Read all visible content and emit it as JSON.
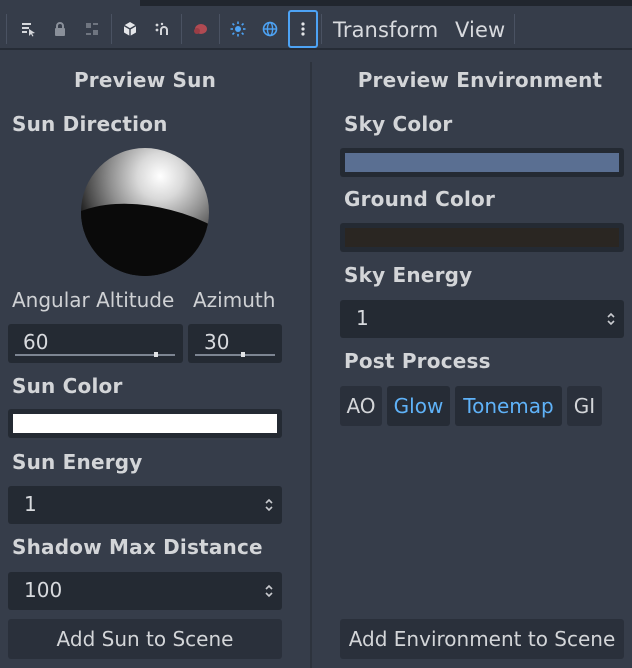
{
  "toolbar": {
    "icons": [
      "list-select-icon",
      "lock-icon",
      "group-icon",
      "cube-icon",
      "snap-icon",
      "paint-icon",
      "sun-icon",
      "globe-icon",
      "more-vertical-icon"
    ],
    "menus": [
      "Transform",
      "View"
    ]
  },
  "preview_sun": {
    "heading": "Preview Sun",
    "direction_label": "Sun Direction",
    "angular_altitude_label": "Angular Altitude",
    "azimuth_label": "Azimuth",
    "angular_altitude_value": "60",
    "azimuth_value": "30",
    "angular_altitude_fraction": 0.88,
    "azimuth_fraction": 0.6,
    "color_label": "Sun Color",
    "color": "#ffffff",
    "energy_label": "Sun Energy",
    "energy_value": "1",
    "shadow_label": "Shadow Max Distance",
    "shadow_value": "100",
    "add_button": "Add Sun to Scene"
  },
  "preview_environment": {
    "heading": "Preview Environment",
    "sky_color_label": "Sky Color",
    "sky_color": "#5a6f92",
    "ground_color_label": "Ground Color",
    "ground_color": "#2a2622",
    "sky_energy_label": "Sky Energy",
    "sky_energy_value": "1",
    "post_process_label": "Post Process",
    "post_process": [
      {
        "label": "AO",
        "enabled": false
      },
      {
        "label": "Glow",
        "enabled": true
      },
      {
        "label": "Tonemap",
        "enabled": true
      },
      {
        "label": "GI",
        "enabled": false
      }
    ],
    "add_button": "Add Environment to Scene"
  },
  "colors": {
    "accent": "#4da3f5",
    "toggle_on_text": "#5fb2f8"
  }
}
